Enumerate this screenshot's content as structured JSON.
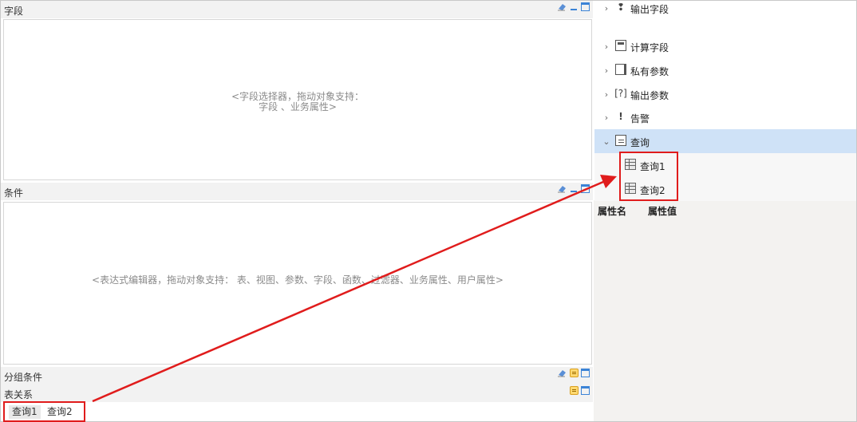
{
  "panels": {
    "fields": {
      "title": "字段",
      "hint_line1": "<字段选择器，拖动对象支持：",
      "hint_line2": "字段 、业务属性>"
    },
    "conditions": {
      "title": "条件",
      "hint": "<表达式编辑器，拖动对象支持： 表、视图、参数、字段、函数、过滤器、业务属性、用户属性>"
    },
    "group": {
      "title": "分组条件"
    },
    "relations": {
      "title": "表关系",
      "tabs": [
        "查询1",
        "查询2"
      ]
    }
  },
  "tree": {
    "items": [
      {
        "label": "输出字段",
        "icon": "output-field-icon"
      },
      {
        "label": "计算字段",
        "icon": "calculator-icon"
      },
      {
        "label": "私有参数",
        "icon": "private-param-icon"
      },
      {
        "label": "输出参数",
        "icon": "output-param-icon",
        "glyph": "[?]"
      },
      {
        "label": "告警",
        "icon": "alert-icon",
        "glyph": "!"
      },
      {
        "label": "查询",
        "icon": "query-folder-icon",
        "expanded": true,
        "selected": true
      }
    ],
    "children": [
      {
        "label": "查询1",
        "icon": "table-icon"
      },
      {
        "label": "查询2",
        "icon": "table-icon"
      }
    ]
  },
  "properties": {
    "name_header": "属性名",
    "value_header": "属性值"
  },
  "colors": {
    "highlight": "#e01c1c",
    "selection": "#cfe2f7",
    "accent": "#3b83d6"
  }
}
